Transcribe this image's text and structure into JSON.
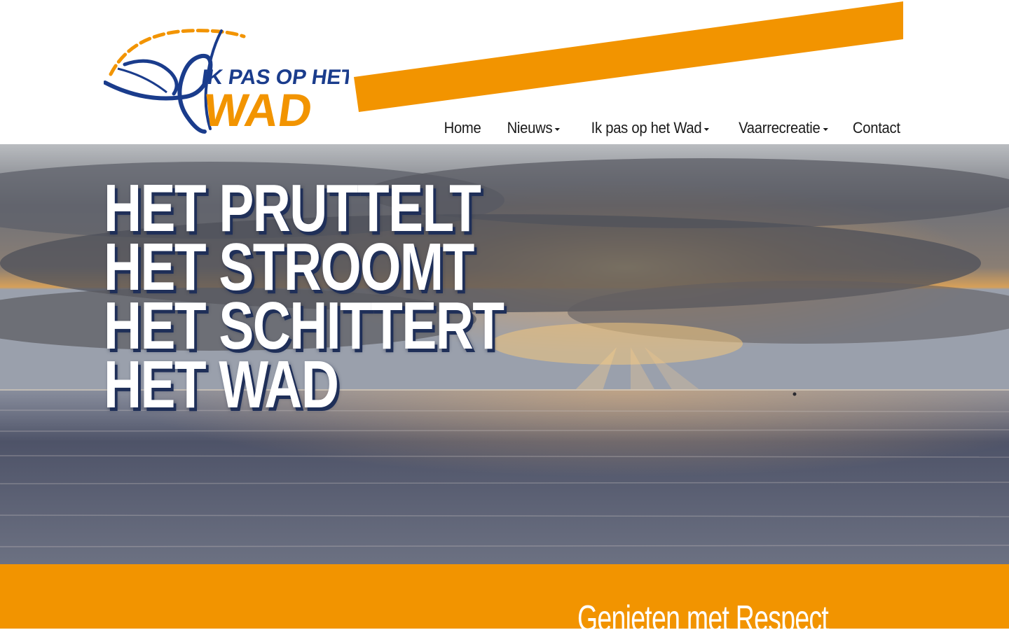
{
  "brand": {
    "logo_line1": "IK PAS OP HET",
    "logo_line2": "WAD",
    "colors": {
      "orange": "#f29400",
      "navy": "#1a3c8c"
    }
  },
  "nav": {
    "items": [
      {
        "label": "Home",
        "dropdown": false
      },
      {
        "label": "Nieuws",
        "dropdown": true
      },
      {
        "label": "Ik pas op het Wad",
        "dropdown": true
      },
      {
        "label": "Vaarrecreatie",
        "dropdown": true
      },
      {
        "label": "Contact",
        "dropdown": false
      }
    ]
  },
  "hero": {
    "lines": [
      "HET PRUTTELT",
      "HET STROOMT",
      "HET SCHITTERT",
      "HET WAD"
    ],
    "image": "sunset over the Wadden sea with sun rays through clouds"
  },
  "band": {
    "title": "Genieten met Respect"
  }
}
